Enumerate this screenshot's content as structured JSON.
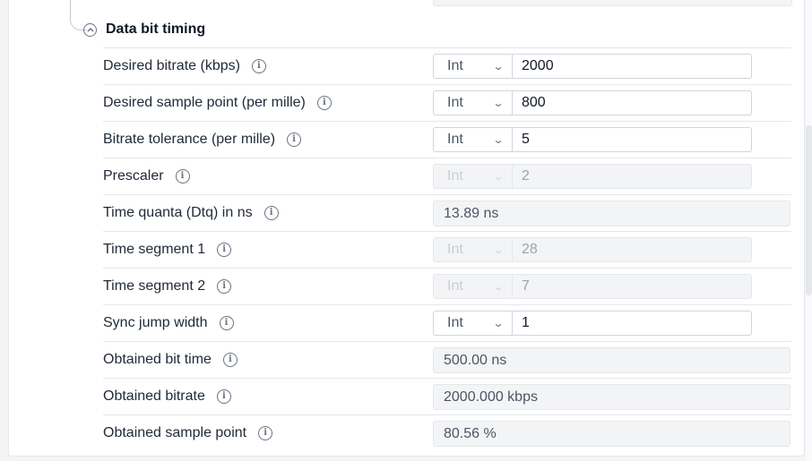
{
  "section": {
    "title": "Data bit timing"
  },
  "rows": [
    {
      "label": "Desired bitrate (kbps)",
      "type": "Int",
      "value": "2000"
    },
    {
      "label": "Desired sample point (per mille)",
      "type": "Int",
      "value": "800"
    },
    {
      "label": "Bitrate tolerance (per mille)",
      "type": "Int",
      "value": "5"
    },
    {
      "label": "Prescaler",
      "type": "Int",
      "value": "2"
    },
    {
      "label": "Time quanta (Dtq) in ns",
      "value": "13.89 ns"
    },
    {
      "label": "Time segment 1",
      "type": "Int",
      "value": "28"
    },
    {
      "label": "Time segment 2",
      "type": "Int",
      "value": "7"
    },
    {
      "label": "Sync jump width",
      "type": "Int",
      "value": "1"
    },
    {
      "label": "Obtained bit time",
      "value": "500.00 ns"
    },
    {
      "label": "Obtained bitrate",
      "value": "2000.000 kbps"
    },
    {
      "label": "Obtained sample point",
      "value": "80.56 %"
    }
  ]
}
